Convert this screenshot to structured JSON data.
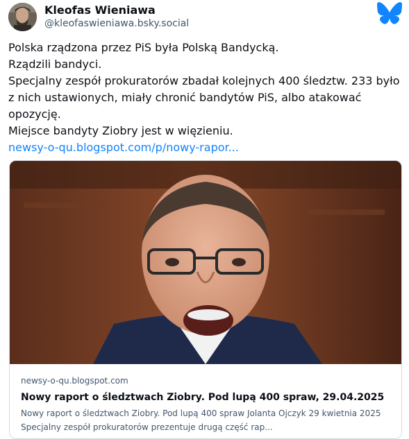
{
  "author": {
    "display_name": "Kleofas Wieniawa",
    "handle": "@kleofaswieniawa.bsky.social"
  },
  "post": {
    "lines": [
      "Polska rządzona przez PiS była Polską Bandycką.",
      "Rządzili bandyci.",
      "Specjalny zespół prokuratorów zbadał kolejnych 400 śledztw. 233 było",
      "z nich ustawionych, miały chronić bandytów PiS, albo atakować",
      "opozycję.",
      "Miejsce bandyty Ziobry jest w więzieniu."
    ],
    "link_text": "newsy-o-qu.blogspot.com/p/nowy-rapor..."
  },
  "card": {
    "domain": "newsy-o-qu.blogspot.com",
    "title": "Nowy raport o śledztwach Ziobry. Pod lupą 400 spraw, 29.04.2025",
    "description_lines": [
      "Nowy raport o śledztwach Ziobry. Pod lupą 400 spraw Jolanta Ojczyk 29 kwietnia 2025",
      "Specjalny zespół prokuratorów prezentuje drugą część rap..."
    ]
  },
  "colors": {
    "link": "#1083fe",
    "bluesky_brand": "#1185fe",
    "muted_text": "#42576c",
    "border": "#d4dbe2"
  },
  "icons": {
    "service_logo": "bluesky-butterfly-icon"
  }
}
